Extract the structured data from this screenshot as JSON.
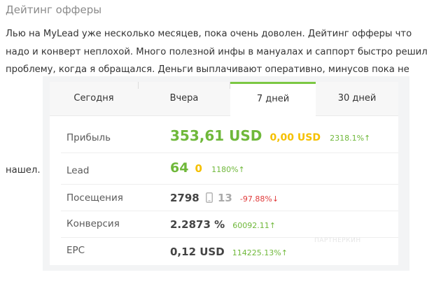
{
  "heading": "Дейтинг офферы",
  "paragraph": [
    "Лью на MyLead уже несколько месяцев, пока очень доволен. Дейтинг офферы что",
    "надо и конверт неплохой. Много полезной инфы в мануалах и саппорт быстро решил",
    "проблему, когда я обращался. Деньги выплачивают оперативно, минусов пока не"
  ],
  "paragraph_tail": "нашел.",
  "tabs": [
    {
      "label": "Сегодня"
    },
    {
      "label": "Вчера"
    },
    {
      "label": "7 дней",
      "active": true
    },
    {
      "label": "30 дней"
    }
  ],
  "stats": {
    "profit": {
      "label": "Прибыль",
      "main": "353,61 USD",
      "secondary": "0,00 USD",
      "change": "2318.1%",
      "direction": "up"
    },
    "lead": {
      "label": "Lead",
      "main": "64",
      "secondary": "0",
      "change": "1180%",
      "direction": "up"
    },
    "visits": {
      "label": "Посещения",
      "main": "2798",
      "secondary": "13",
      "change": "-97.88%",
      "direction": "down",
      "icon": "phone-icon"
    },
    "conversion": {
      "label": "Конверсия",
      "main": "2.2873 %",
      "change": "60092.11",
      "direction": "up"
    },
    "epc": {
      "label": "EPC",
      "main": "0,12 USD",
      "change": "114225.13%",
      "direction": "up"
    }
  },
  "watermark": "ПАРТНЕРКИН",
  "colors": {
    "accent": "#7bc843",
    "value_green": "#6fb83a",
    "value_yellow": "#f5c000",
    "negative": "#e03a3a"
  },
  "arrows": {
    "up": "↑",
    "down": "↓"
  }
}
